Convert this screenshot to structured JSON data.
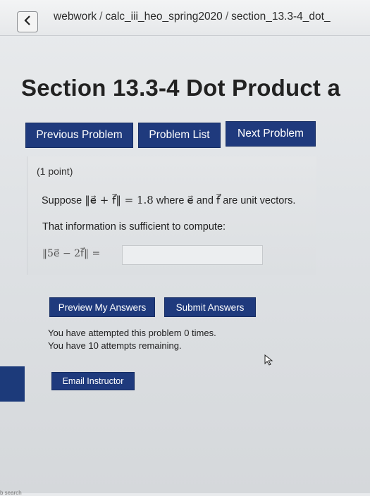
{
  "breadcrumb": {
    "part1": "webwork",
    "sep1": "/",
    "part2": "calc_iii_heo_spring2020",
    "sep2": "/",
    "part3": "section_13.3-4_dot_"
  },
  "page_title": "Section 13.3-4 Dot Product a",
  "nav": {
    "previous": "Previous Problem",
    "list": "Problem List",
    "next": "Next Problem"
  },
  "problem": {
    "points": "(1 point)",
    "suppose": "Suppose",
    "norm_expr": "‖e⃗ + f⃗‖ = 1.8",
    "where": "where",
    "e_vec": "e⃗",
    "and": "and",
    "f_vec": "f⃗",
    "unit": "are unit vectors.",
    "info": "That information is sufficient to compute:",
    "compute_expr": "‖5e⃗ − 2f⃗‖ =",
    "answer_value": ""
  },
  "actions": {
    "preview": "Preview My Answers",
    "submit": "Submit Answers"
  },
  "attempts": {
    "line1": "You have attempted this problem 0 times.",
    "line2": "You have 10 attempts remaining."
  },
  "email_label": "Email Instructor",
  "footer_text": "b search",
  "colors": {
    "button_bg": "#1f3a7d",
    "button_text": "#ffffff",
    "page_bg": "#e3e5e8"
  },
  "icons": {
    "back": "chevron-left-icon",
    "cursor": "mouse-pointer-icon"
  }
}
